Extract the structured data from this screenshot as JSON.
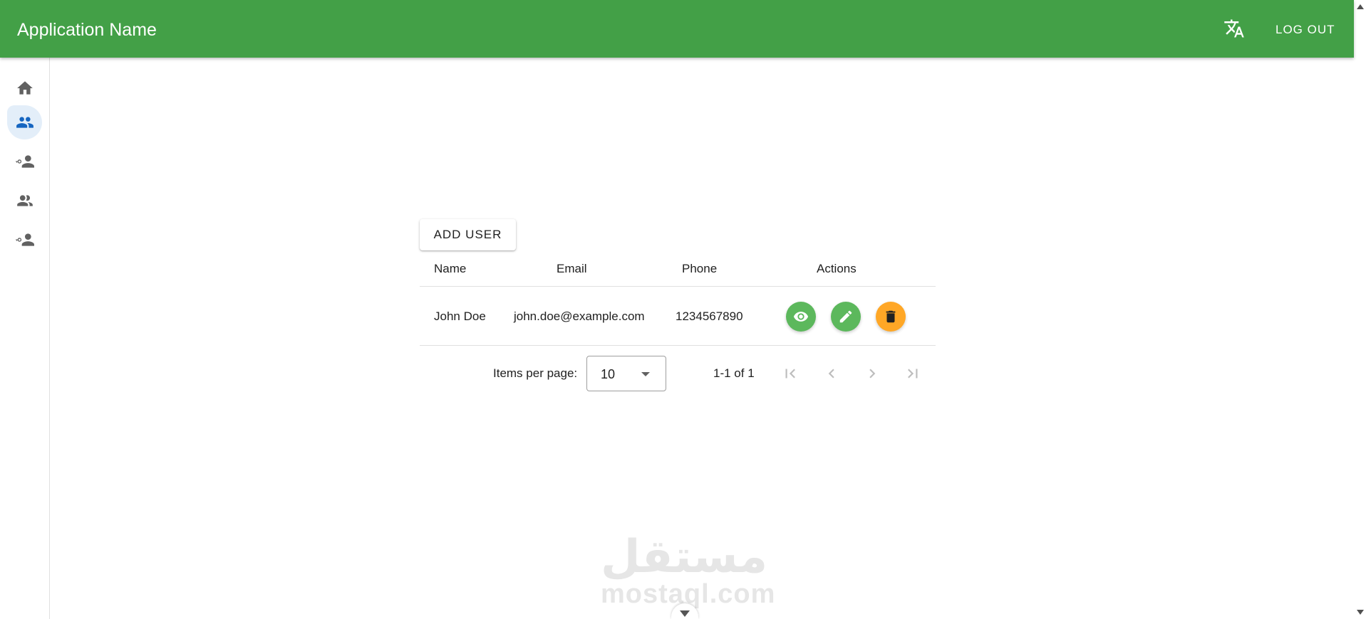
{
  "app": {
    "title": "Application Name",
    "logout_label": "LOG OUT",
    "accent_color": "#43a047"
  },
  "sidenav": {
    "items": [
      {
        "icon": "home-icon",
        "active": false
      },
      {
        "icon": "people-icon",
        "active": true
      },
      {
        "icon": "user-key-icon",
        "active": false
      },
      {
        "icon": "group-icon",
        "active": false
      },
      {
        "icon": "user-key-icon",
        "active": false
      }
    ]
  },
  "users": {
    "add_button_label": "ADD USER",
    "columns": [
      "Name",
      "Email",
      "Phone",
      "Actions"
    ],
    "rows": [
      {
        "name": "John Doe",
        "email": "john.doe@example.com",
        "phone": "1234567890"
      }
    ],
    "actions": [
      {
        "icon": "eye-icon",
        "color": "#5cb85c"
      },
      {
        "icon": "pencil-icon",
        "color": "#5cb85c"
      },
      {
        "icon": "trash-icon",
        "color": "#ffa726"
      }
    ]
  },
  "paginator": {
    "items_per_page_label": "Items per page:",
    "items_per_page_value": "10",
    "range_label": "1-1 of 1"
  },
  "watermark": {
    "arabic": "مستقل",
    "latin": "mostaql.com"
  }
}
